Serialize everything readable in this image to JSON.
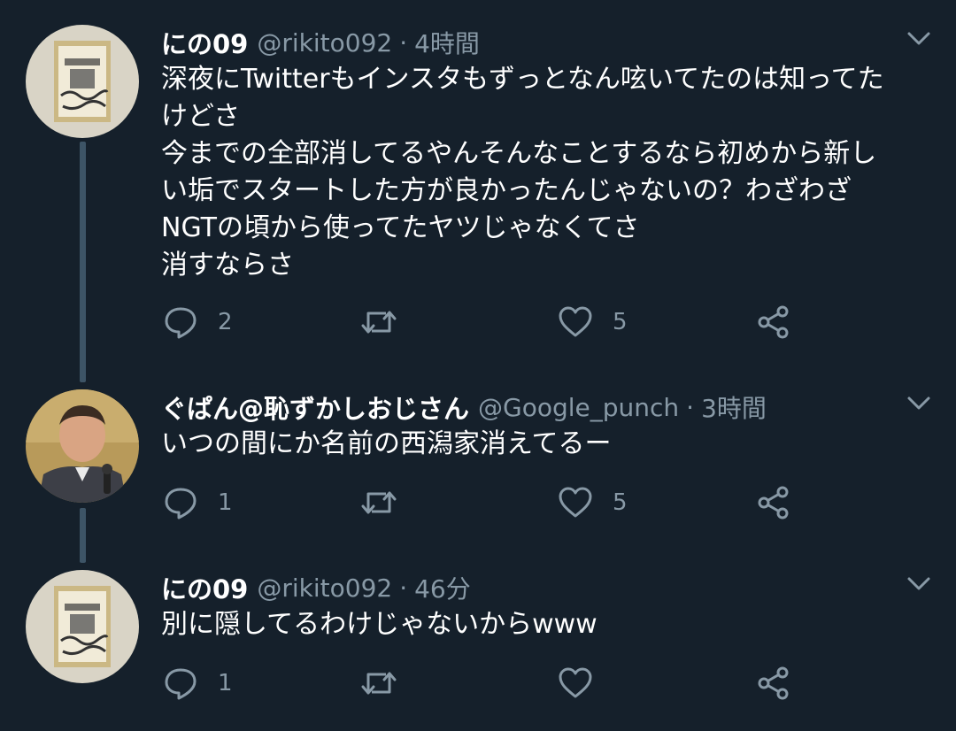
{
  "colors": {
    "background": "#15202b",
    "text": "#ffffff",
    "secondary": "#8899a6",
    "thread_line": "#3d5466"
  },
  "tweets": [
    {
      "display_name": "にの09",
      "handle": "@rikito092",
      "separator": "·",
      "time": "4時間",
      "lines": [
        "深夜にTwitterもインスタもずっとなん呟いてたのは知ってた",
        "けどさ",
        "今までの全部消してるやんそんなことするなら初めから新し",
        "い垢でスタートした方が良かったんじゃないの？わざわざ",
        "NGTの頃から使ってたヤツじゃなくてさ",
        "消すならさ"
      ],
      "replies": "2",
      "retweets": "",
      "likes": "5",
      "avatar_icon": "poster-avatar-icon"
    },
    {
      "display_name": "ぐぱん@恥ずかしおじさん",
      "handle": "@Google_punch",
      "separator": "·",
      "time": "3時間",
      "lines": [
        "いつの間にか名前の西潟家消えてるー"
      ],
      "replies": "1",
      "retweets": "",
      "likes": "5",
      "avatar_icon": "person-avatar-icon"
    },
    {
      "display_name": "にの09",
      "handle": "@rikito092",
      "separator": "·",
      "time": "46分",
      "lines": [
        "別に隠してるわけじゃないからwww"
      ],
      "replies": "1",
      "retweets": "",
      "likes": "",
      "avatar_icon": "poster-avatar-icon"
    }
  ]
}
